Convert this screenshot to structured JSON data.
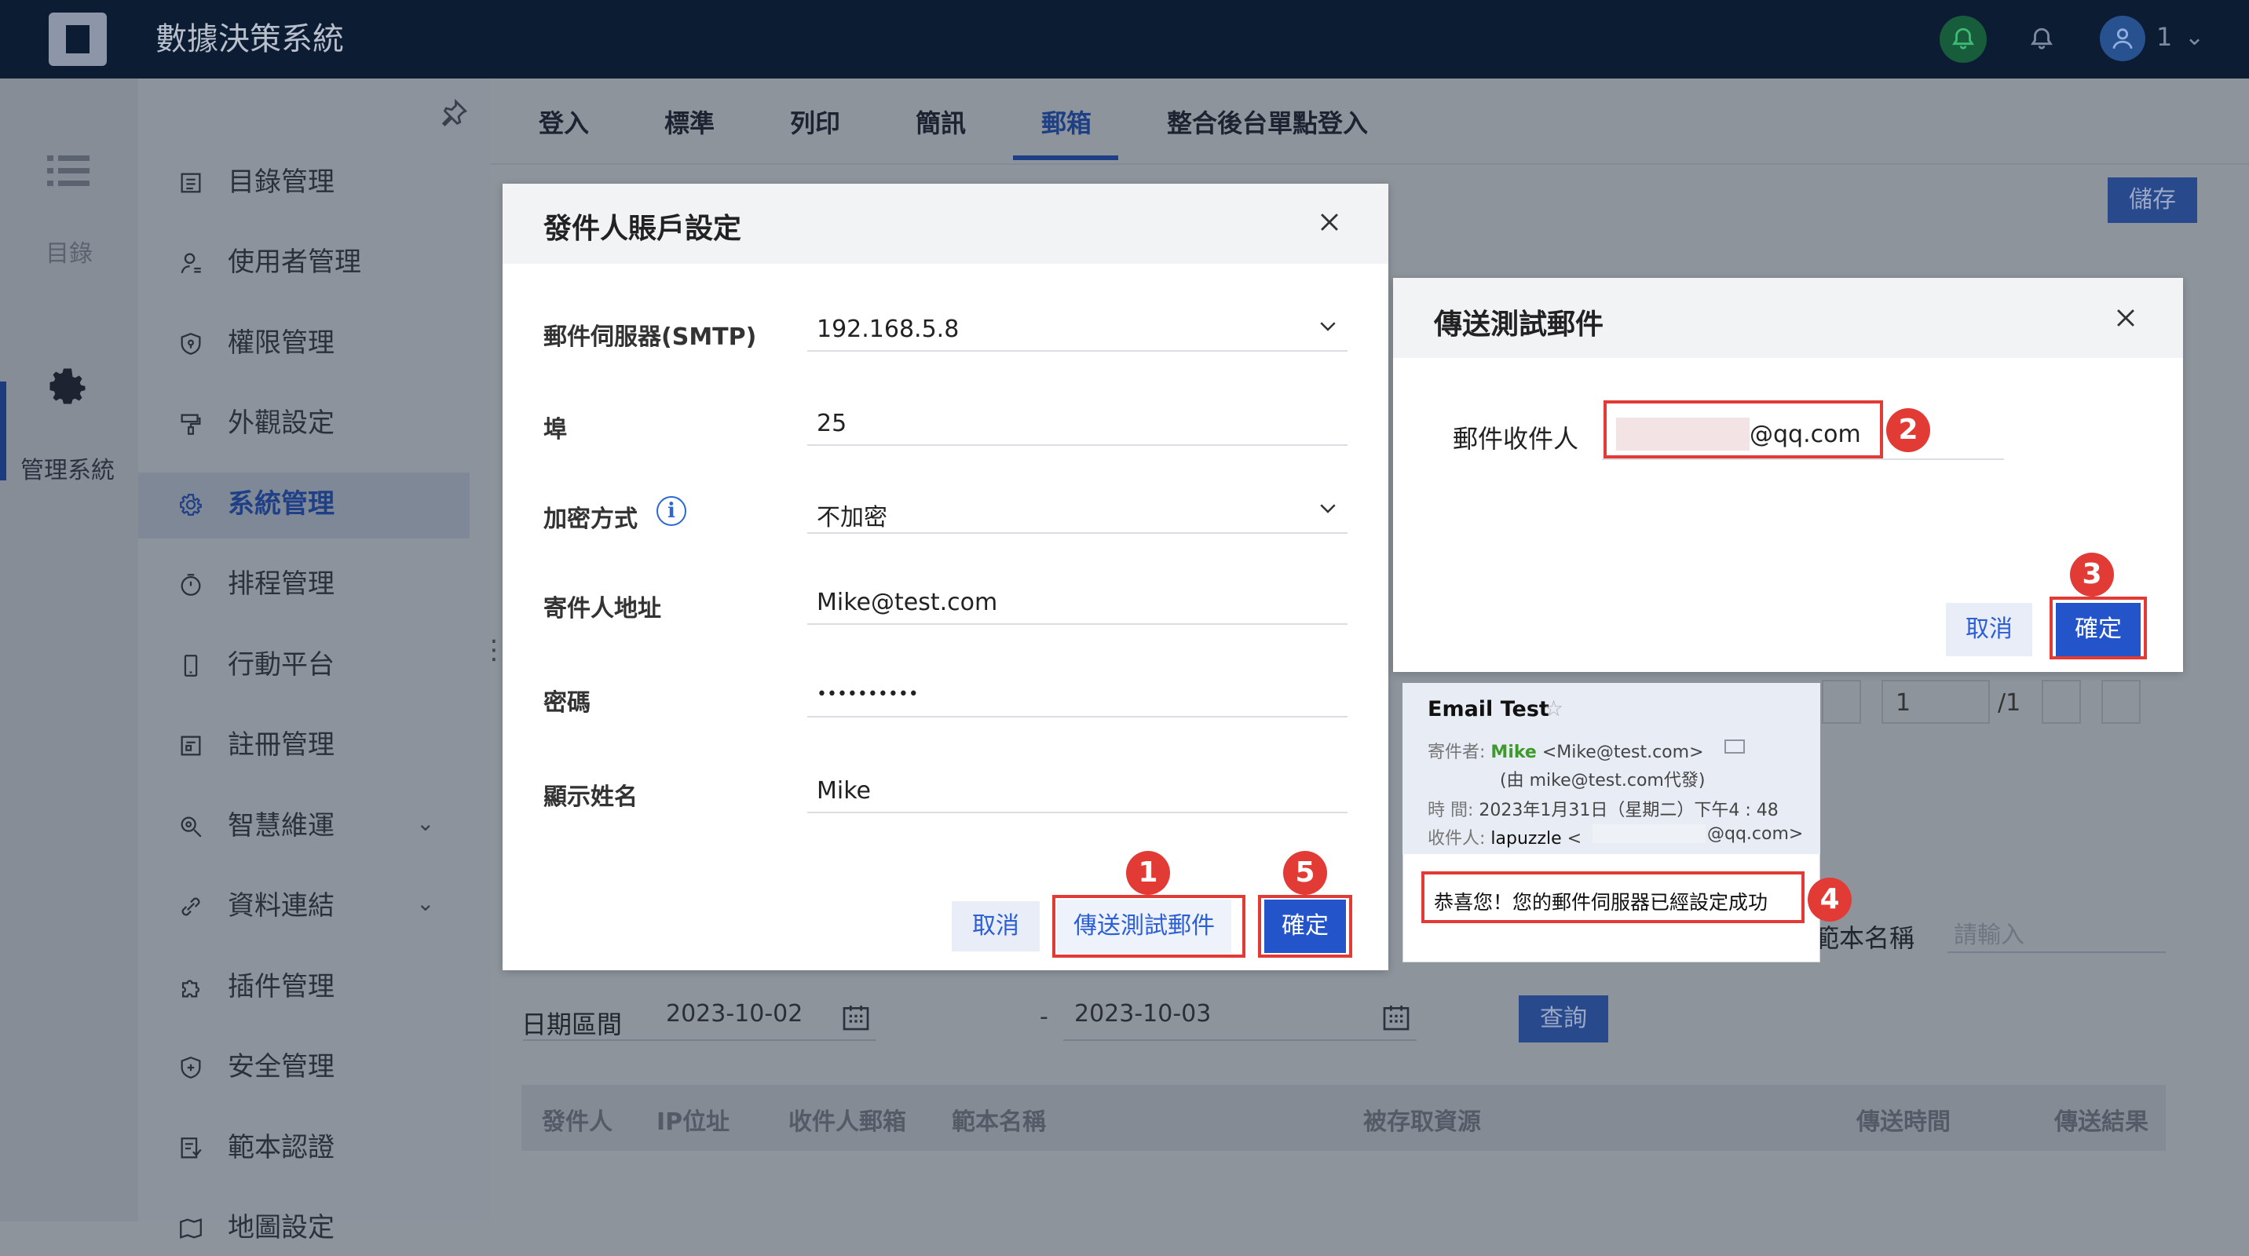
{
  "app": {
    "title": "數據決策系統",
    "user_number": "1"
  },
  "rail": {
    "menu_label": "目錄",
    "system_label": "管理系統"
  },
  "sidebar": {
    "items": [
      {
        "label": "目錄管理",
        "icon": "list-icon"
      },
      {
        "label": "使用者管理",
        "icon": "user-icon"
      },
      {
        "label": "權限管理",
        "icon": "shield-lock-icon"
      },
      {
        "label": "外觀設定",
        "icon": "paint-roller-icon"
      },
      {
        "label": "系統管理",
        "icon": "gear-icon",
        "active": true
      },
      {
        "label": "排程管理",
        "icon": "timer-icon"
      },
      {
        "label": "行動平台",
        "icon": "mobile-icon"
      },
      {
        "label": "註冊管理",
        "icon": "register-icon"
      },
      {
        "label": "智慧維運",
        "icon": "search-gear-icon",
        "expandable": true
      },
      {
        "label": "資料連結",
        "icon": "link-icon",
        "expandable": true
      },
      {
        "label": "插件管理",
        "icon": "puzzle-icon"
      },
      {
        "label": "安全管理",
        "icon": "shield-plus-icon"
      },
      {
        "label": "範本認證",
        "icon": "certificate-icon"
      },
      {
        "label": "地圖設定",
        "icon": "map-icon"
      }
    ]
  },
  "tabs": [
    "登入",
    "標準",
    "列印",
    "簡訊",
    "郵箱",
    "整合後台單點登入"
  ],
  "active_tab": "郵箱",
  "main": {
    "save_label": "儲存",
    "date_label": "日期區間",
    "date_from": "2023-10-02",
    "date_separator": "-",
    "date_to": "2023-10-03",
    "query_label": "查詢",
    "template_label": "範本名稱",
    "template_placeholder": "請輸入",
    "pager_page": "1",
    "pager_total": "/1",
    "columns": [
      "發件人",
      "IP位址",
      "收件人郵箱",
      "範本名稱",
      "被存取資源",
      "傳送時間",
      "傳送結果"
    ]
  },
  "sender_dialog": {
    "title": "發件人賬戶設定",
    "fields": [
      {
        "label": "郵件伺服器(SMTP)",
        "value": "192.168.5.8"
      },
      {
        "label": "埠",
        "value": "25"
      },
      {
        "label": "加密方式",
        "value": "不加密"
      },
      {
        "label": "寄件人地址",
        "value": "Mike@test.com"
      },
      {
        "label": "密碼",
        "value": "••••••••••"
      },
      {
        "label": "顯示姓名",
        "value": "Mike"
      }
    ],
    "cancel_label": "取消",
    "test_label": "傳送測試郵件",
    "confirm_label": "確定"
  },
  "test_dialog": {
    "title": "傳送測試郵件",
    "recipient_label": "郵件收件人",
    "recipient_value": "@qq.com",
    "cancel_label": "取消",
    "confirm_label": "確定"
  },
  "email_preview": {
    "subject": "Email Test",
    "from_key": "寄件者:",
    "from_name": "Mike",
    "from_addr": "<Mike@test.com>",
    "on_behalf": "(由 mike@test.com代發)",
    "time_key": "時  間:",
    "time_value": "2023年1月31日（星期二）下午4 : 48",
    "to_key": "收件人:",
    "to_name": "lapuzzle",
    "to_addr_start": "<",
    "to_addr_end": "@qq.com>",
    "message": "恭喜您！您的郵件伺服器已經設定成功"
  },
  "annotations": [
    "1",
    "2",
    "3",
    "4",
    "5"
  ],
  "colors": {
    "primary": "#2354c9",
    "annotation_red": "#e23b36",
    "topbar": "#0c1c33"
  }
}
